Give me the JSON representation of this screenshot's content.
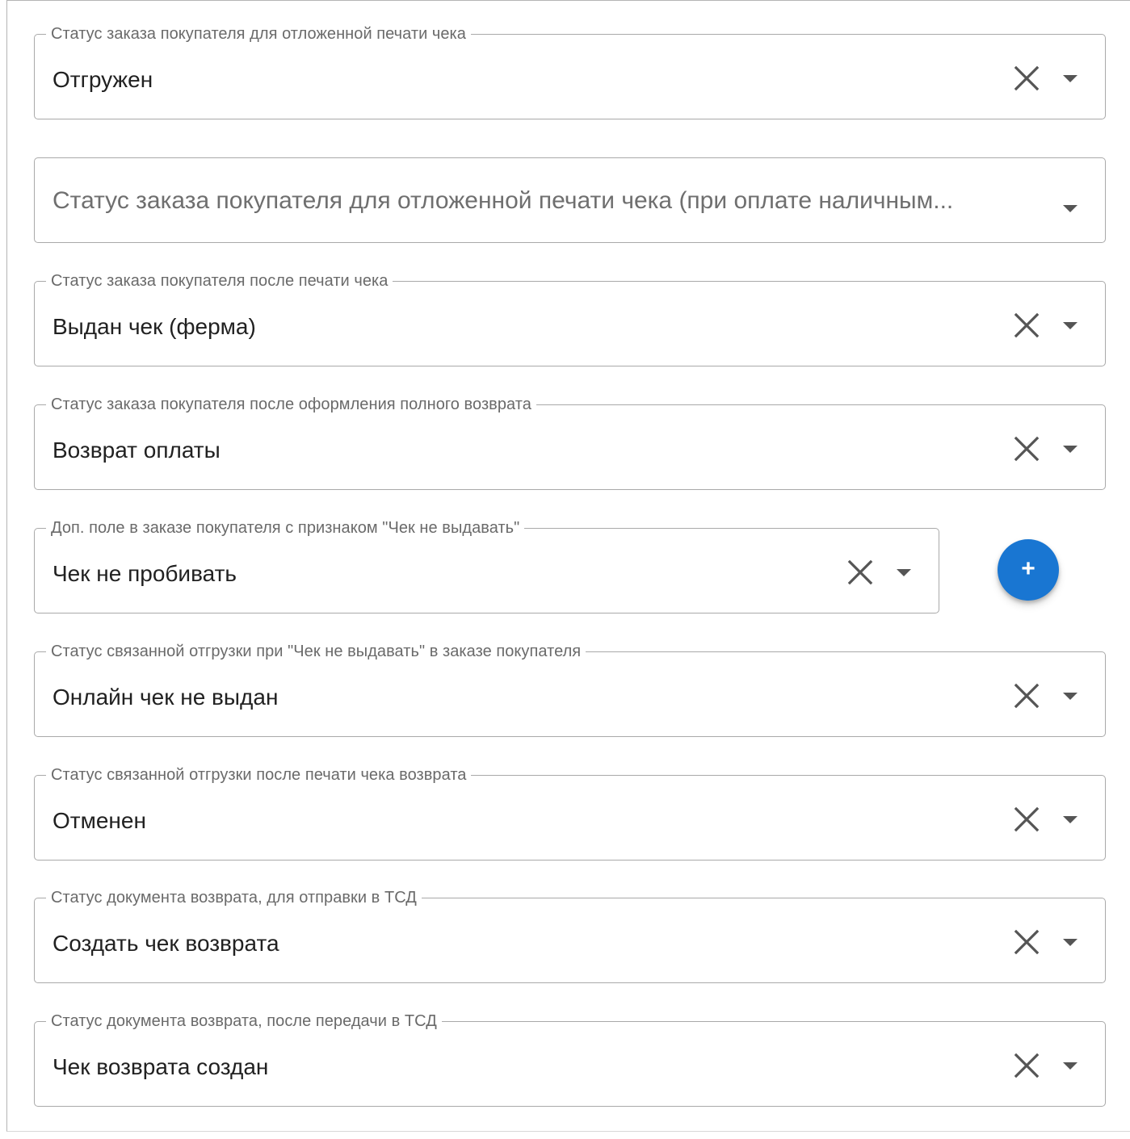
{
  "icons": {
    "clear": "close-icon",
    "dropdown": "arrow-drop-down-icon",
    "add": "plus-icon"
  },
  "colors": {
    "accent": "#1976d2",
    "border": "#a9a9a9",
    "label": "#6a6a6a",
    "text": "#212121"
  },
  "fields": [
    {
      "label": "Статус заказа покупателя для отложенной печати чека",
      "value": "Отгружен"
    },
    {
      "placeholder": "Статус заказа покупателя для отложенной печати чека (при оплате наличным..."
    },
    {
      "label": "Статус заказа покупателя после печати чека",
      "value": "Выдан чек (ферма)"
    },
    {
      "label": "Статус заказа покупателя после оформления полного возврата",
      "value": "Возврат оплаты"
    },
    {
      "label": "Доп. поле в заказе покупателя с признаком \"Чек не выдавать\"",
      "value": "Чек не пробивать"
    },
    {
      "label": "Статус связанной отгрузки при \"Чек не выдавать\" в заказе покупателя",
      "value": "Онлайн чек не выдан"
    },
    {
      "label": "Статус связанной отгрузки после печати чека возврата",
      "value": "Отменен"
    },
    {
      "label": "Статус документа возврата, для отправки в ТСД",
      "value": "Создать чек возврата"
    },
    {
      "label": "Статус документа возврата, после передачи в ТСД",
      "value": "Чек возврата создан"
    }
  ],
  "add_button": {
    "symbol": "+"
  }
}
